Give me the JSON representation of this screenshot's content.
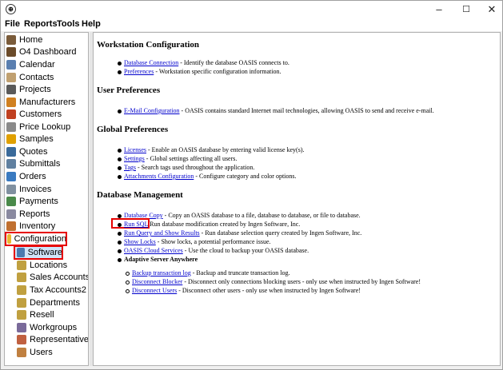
{
  "window": {
    "icon_glyph": "⊕",
    "minimize": "–",
    "maximize": "☐",
    "close": "✕"
  },
  "menu": [
    "File",
    "Reports",
    "Tools",
    "Help"
  ],
  "sidebar": {
    "items": [
      {
        "label": "Home",
        "icon": "home-icon",
        "color": "#7a5b3a"
      },
      {
        "label": "O4 Dashboard",
        "icon": "dashboard-icon",
        "color": "#6b4b2a"
      },
      {
        "label": "Calendar",
        "icon": "calendar-icon",
        "color": "#5a7fb0"
      },
      {
        "label": "Contacts",
        "icon": "contacts-icon",
        "color": "#c0a070"
      },
      {
        "label": "Projects",
        "icon": "projects-icon",
        "color": "#5a5a5a"
      },
      {
        "label": "Manufacturers",
        "icon": "manufacturers-icon",
        "color": "#d08020"
      },
      {
        "label": "Customers",
        "icon": "customers-icon",
        "color": "#c04020"
      },
      {
        "label": "Price Lookup",
        "icon": "price-lookup-icon",
        "color": "#8a8a8a"
      },
      {
        "label": "Samples",
        "icon": "samples-icon",
        "color": "#e0a000"
      },
      {
        "label": "Quotes",
        "icon": "quotes-icon",
        "color": "#3a6a9a"
      },
      {
        "label": "Submittals",
        "icon": "submittals-icon",
        "color": "#6080a0"
      },
      {
        "label": "Orders",
        "icon": "orders-icon",
        "color": "#3a7ac0"
      },
      {
        "label": "Invoices",
        "icon": "invoices-icon",
        "color": "#8090a0"
      },
      {
        "label": "Payments",
        "icon": "payments-icon",
        "color": "#4a8a4a"
      },
      {
        "label": "Reports",
        "icon": "reports-icon",
        "color": "#8a8aa0"
      },
      {
        "label": "Inventory",
        "icon": "inventory-icon",
        "color": "#c07030"
      },
      {
        "label": "Configuration",
        "icon": "configuration-folder-icon",
        "color": "#e8b830"
      },
      {
        "label": "Software",
        "icon": "software-icon",
        "color": "#4a7ab0"
      },
      {
        "label": "Locations",
        "icon": "locations-icon",
        "color": "#c0a040"
      },
      {
        "label": "Sales Accounts",
        "icon": "sales-accounts-icon",
        "color": "#c0a040"
      },
      {
        "label": "Tax Accounts2",
        "icon": "tax-accounts-icon",
        "color": "#c0a040"
      },
      {
        "label": "Departments",
        "icon": "departments-icon",
        "color": "#c0a040"
      },
      {
        "label": "Resell",
        "icon": "resell-icon",
        "color": "#c0a040"
      },
      {
        "label": "Workgroups",
        "icon": "workgroups-icon",
        "color": "#7a6a9a"
      },
      {
        "label": "Representatives",
        "icon": "representatives-icon",
        "color": "#c06040"
      },
      {
        "label": "Users",
        "icon": "users-icon",
        "color": "#c08040"
      }
    ]
  },
  "content": {
    "workstation": {
      "heading": "Workstation Configuration",
      "items": [
        {
          "link": "Database Connection",
          "text": " - Identify the database OASIS connects to."
        },
        {
          "link": "Preferences",
          "text": " - Workstation specific configuration information."
        }
      ]
    },
    "user_prefs": {
      "heading": "User Preferences",
      "items": [
        {
          "link": "E-Mail Configuration",
          "text": " - OASIS contains standard Internet mail technologies, allowing OASIS to send and receive e-mail."
        }
      ]
    },
    "global_prefs": {
      "heading": "Global Preferences",
      "items": [
        {
          "link": "Licenses",
          "text": " - Enable an OASIS database by entering valid license key(s)."
        },
        {
          "link": "Settings",
          "text": " - Global settings affecting all users."
        },
        {
          "link": "Tags",
          "text": " - Search tags used throughout the application."
        },
        {
          "link": "Attachments Configuration",
          "text": " - Configure category and color options."
        }
      ]
    },
    "db_mgmt": {
      "heading": "Database Management",
      "items": [
        {
          "link": "Database Copy",
          "text": " - Copy an OASIS database to a file, database to database, or file to database."
        },
        {
          "link": "Run SQL",
          "text": " Run database modification created by Ingen Software, Inc."
        },
        {
          "link": "Run Query and Show Results",
          "text": " - Run database selection query created by Ingen Software, Inc."
        },
        {
          "link": "Show Locks",
          "text": " - Show locks, a potential performance issue."
        },
        {
          "link": "OASIS Cloud Services",
          "text": " - Use the cloud to backup your OASIS database."
        }
      ],
      "adaptive_label": "Adaptive Server Anywhere",
      "sub_items": [
        {
          "link": "Backup transaction log",
          "text": " - Backup and truncate transaction log."
        },
        {
          "link": "Disconnect Blocker",
          "text": " - Disconnect only connections blocking users - only use when instructed by Ingen Software!"
        },
        {
          "link": "Disconnect Users",
          "text": " - Disconnect other users - only use when instructed by Ingen Software!"
        }
      ]
    }
  }
}
